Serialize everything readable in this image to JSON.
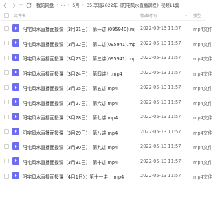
{
  "nav": {
    "more": "···",
    "breadcrumbs": [
      "我的网盘",
      "...",
      "5月",
      "35.李谱2022年《阳宅风水直播课程》视频11集"
    ]
  },
  "header": {
    "name": "文件名",
    "time": "修改时间",
    "type": "类型"
  },
  "files": [
    {
      "name": "阳宅风水直播面授课（3月21日）：第一讲.(095940).mp4",
      "time": "2022-05-13 11:57",
      "type": "mp4文件"
    },
    {
      "name": "阳宅风水直播面授课（3月22日）：第二讲(095941).mp4",
      "time": "2022-05-13 11:57",
      "type": "mp4文件"
    },
    {
      "name": "阳宅风水直播面授课（3月23日）：第三讲(095941).mp4",
      "time": "2022-05-13 11:57",
      "type": "mp4文件"
    },
    {
      "name": "阳宅风水直播面授课（3月24日）：第四讲！.mp4",
      "time": "2022-05-13 11:57",
      "type": "mp4文件"
    },
    {
      "name": "阳宅风水直播面授课（3月25日）：第五讲.mp4",
      "time": "2022-05-13 11:57",
      "type": "mp4文件"
    },
    {
      "name": "阳宅风水直播面授课（3月27日）：第六讲.mp4",
      "time": "2022-05-13 11:57",
      "type": "mp4文件"
    },
    {
      "name": "阳宅风水直播面授课（3月28日）：第七讲.mp4",
      "time": "2022-05-13 11:57",
      "type": "mp4文件"
    },
    {
      "name": "阳宅风水直播面授课（3月29日）：第八讲.mp4",
      "time": "2022-05-13 11:57",
      "type": "mp4文件"
    },
    {
      "name": "阳宅风水直播面授课（3月30日）：第九讲.mp4",
      "time": "2022-05-13 11:57",
      "type": "mp4文件"
    },
    {
      "name": "阳宅风水直播面授课（3月31日）：第十讲.mp4",
      "time": "2022-05-13 11:57",
      "type": "mp4文件"
    },
    {
      "name": "阳宅风水直播面授课（4月1日）：第十一讲！.mp4",
      "time": "2022-05-13 11:57",
      "type": "mp4文件"
    }
  ],
  "colors": {
    "file_icon": "#6d6df2",
    "sort_arrow": "#4a8cf7"
  },
  "icons": {
    "back": "chevron-left-icon",
    "forward": "chevron-right-icon",
    "refresh": "refresh-icon",
    "file": "video-file-icon",
    "sort": "sort-arrow-icon"
  }
}
